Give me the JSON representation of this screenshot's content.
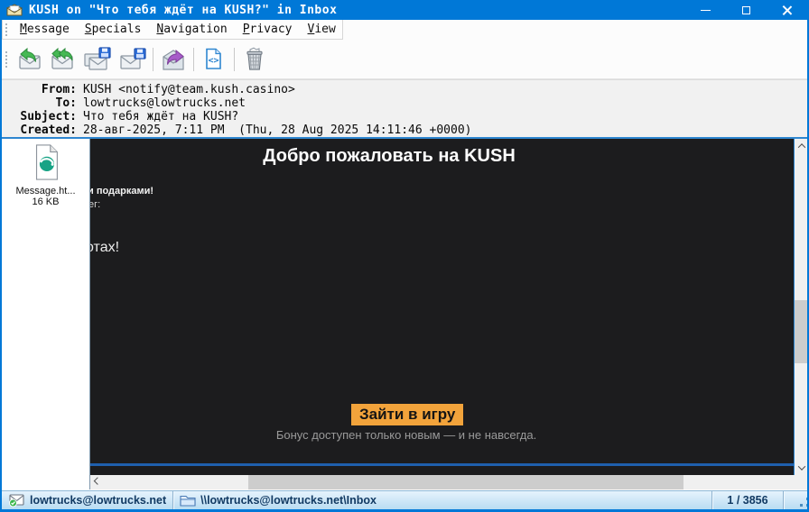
{
  "window": {
    "title": "KUSH on \"Что тебя ждёт на KUSH?\" in Inbox"
  },
  "menu": {
    "items": [
      "Message",
      "Specials",
      "Navigation",
      "Privacy",
      "View"
    ]
  },
  "toolbar": {
    "buttons": [
      "reply",
      "reply-all",
      "copy-to-folder",
      "move-to-folder",
      "forward",
      "view-source",
      "delete"
    ],
    "view_source_glyph": "<>"
  },
  "headers": {
    "rows": [
      {
        "label": "From:",
        "value": "KUSH <notify@team.kush.casino>"
      },
      {
        "label": "To:",
        "value": "lowtrucks@lowtrucks.net"
      },
      {
        "label": "Subject:",
        "value": "Что тебя ждёт на KUSH?"
      },
      {
        "label": "Created:",
        "value": "28-авг-2025, 7:11 PM  (Thu, 28 Aug 2025 14:11:46 +0000)"
      }
    ]
  },
  "attachment": {
    "filename": "Message.ht...",
    "size": "16 KB"
  },
  "email_body": {
    "heading": "Добро пожаловать на KUSH",
    "fragment_1": "и подарками!",
    "fragment_2": "ег:",
    "fragment_3": "отах!",
    "cta_label": "Зайти в игру",
    "note": "Бонус доступен только новым — и не навсегда."
  },
  "statusbar": {
    "account": "lowtrucks@lowtrucks.net",
    "folder": "\\\\lowtrucks@lowtrucks.net\\Inbox",
    "counter": "1 / 3856"
  },
  "colors": {
    "titlebar": "#0078d7",
    "body_bg": "#1c1c1e",
    "cta_bg": "#f2a33b",
    "divider_blue": "#1f5fae",
    "accent_blue": "#2e86d0"
  }
}
